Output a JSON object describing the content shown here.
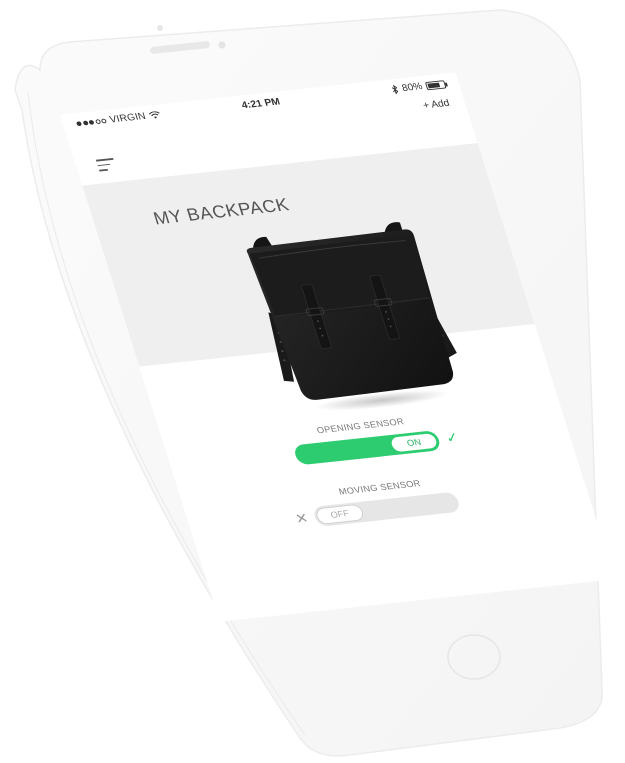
{
  "status_bar": {
    "carrier": "VIRGIN",
    "time": "4:21 PM",
    "battery_percent": "80%",
    "battery_level": 0.8,
    "icons": [
      "signal-dots-icon",
      "wifi-icon",
      "bluetooth-icon",
      "battery-icon"
    ]
  },
  "nav": {
    "menu_icon": "hamburger-menu-icon",
    "add_label": "+ Add"
  },
  "page": {
    "title": "MY BACKPACK",
    "image": "backpack-image"
  },
  "sensors": [
    {
      "label": "OPENING SENSOR",
      "state": "ON",
      "on": true,
      "indicator": "check-icon",
      "indicator_glyph": "✓"
    },
    {
      "label": "MOVING SENSOR",
      "state": "OFF",
      "on": false,
      "indicator": "cross-icon",
      "indicator_glyph": "✕"
    }
  ],
  "colors": {
    "accent_green": "#2ecc71",
    "hero_background": "#efefef",
    "toggle_off": "#e6e6e6"
  }
}
